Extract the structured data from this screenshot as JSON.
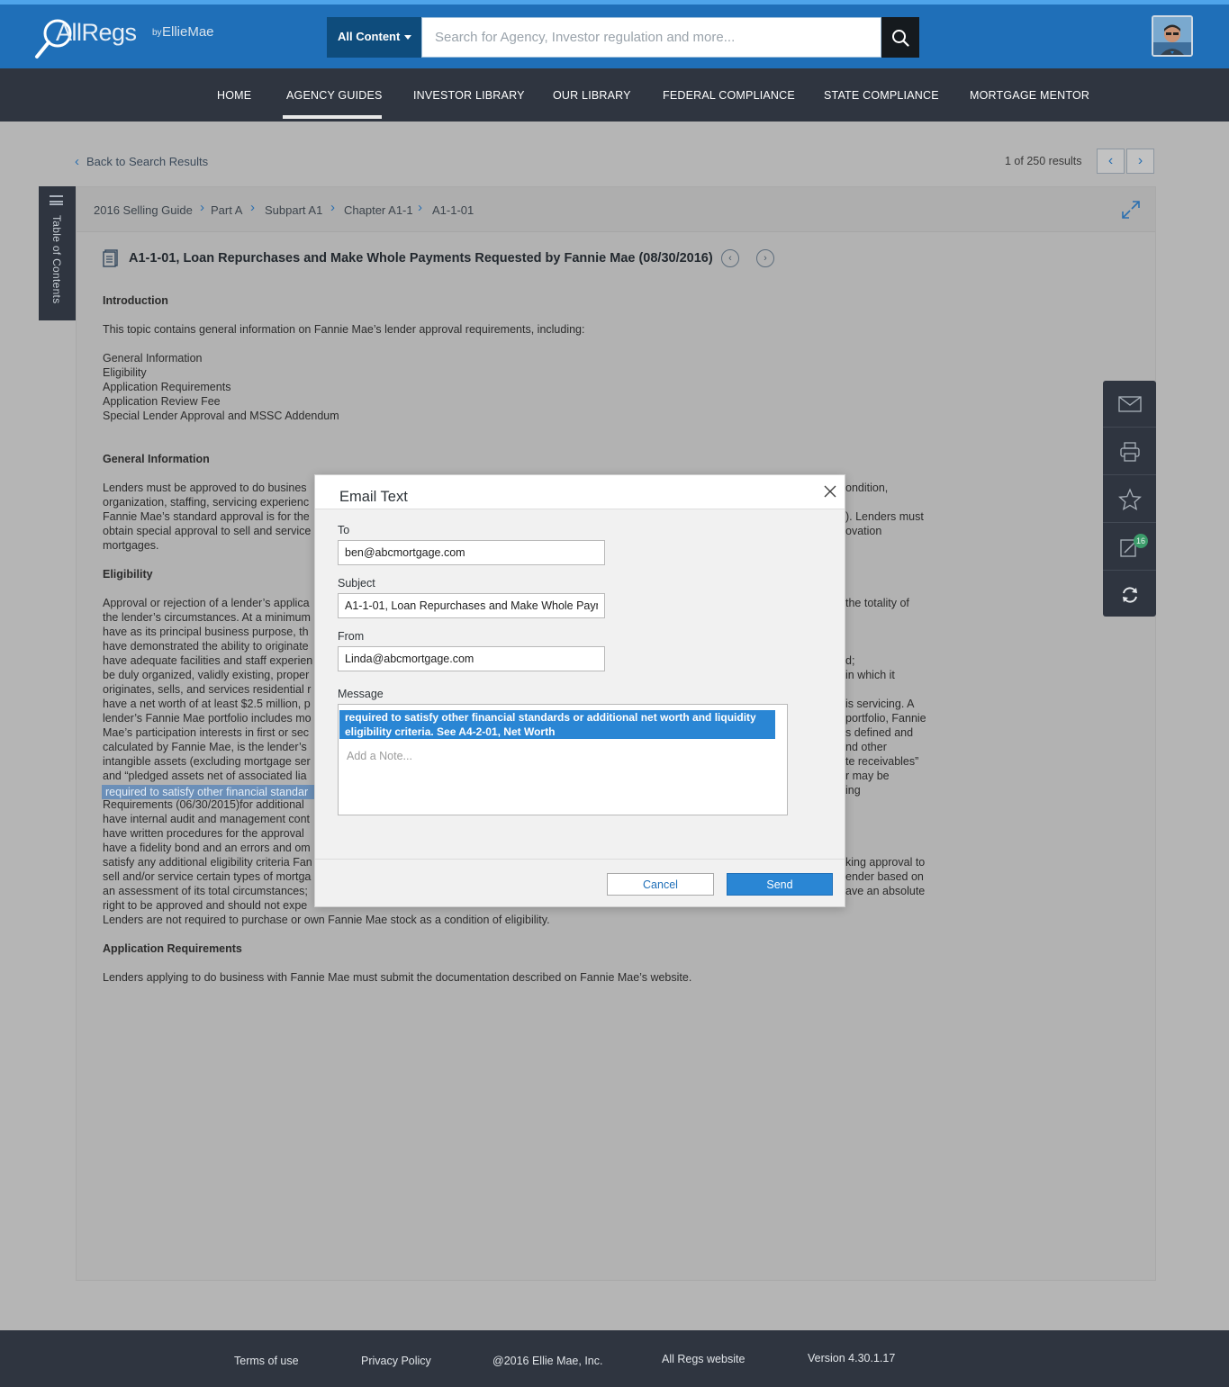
{
  "header": {
    "brand": "AllRegs",
    "by": "by",
    "brand_sub": "EllieMae",
    "search_scope": "All Content",
    "search_placeholder": "Search for Agency, Investor regulation and more..."
  },
  "nav": {
    "items": [
      "HOME",
      "AGENCY GUIDES",
      "INVESTOR LIBRARY",
      "OUR LIBRARY",
      "FEDERAL COMPLIANCE",
      "STATE COMPLIANCE",
      "MORTGAGE MENTOR"
    ],
    "active": "AGENCY GUIDES"
  },
  "results_bar": {
    "back_label": "Back to Search Results",
    "results_text": "1 of 250 results"
  },
  "breadcrumb": [
    "2016 Selling Guide",
    "Part A",
    "Subpart A1",
    "Chapter A1-1",
    "A1-1-01"
  ],
  "toc_label": "Table of Contents",
  "document": {
    "title": "A1-1-01, Loan Repurchases and Make Whole Payments Requested by Fannie Mae (08/30/2016)",
    "intro_heading": "Introduction",
    "intro_text": "This topic contains general information on Fannie Mae’s lender approval requirements, including:",
    "intro_list": [
      "General Information",
      "Eligibility",
      "Application Requirements",
      "Application Review Fee",
      "Special Lender Approval and MSSC Addendum"
    ],
    "general_heading": "General Information",
    "general_lines": [
      "Lenders must be approved to do busines",
      "organization, staffing, servicing experienc",
      "Fannie Mae’s standard approval is for the",
      "obtain special approval to sell and service",
      "mortgages."
    ],
    "general_right": [
      "ondition,",
      "). Lenders must",
      "ovation"
    ],
    "eligibility_heading": "Eligibility",
    "eligibility_lines": [
      "Approval or rejection of a lender’s applica",
      "the lender’s circumstances. At a minimum",
      "have as its principal business purpose, th",
      "have demonstrated the ability to originate",
      "have adequate facilities and staff experien",
      "be duly organized, validly existing, proper",
      "originates, sells, and services residential r",
      "have a net worth of at least $2.5 million, p",
      "lender’s Fannie Mae portfolio includes mo",
      "Mae’s participation interests in first or sec",
      "calculated by Fannie Mae, is the lender’s",
      "intangible assets (excluding mortgage ser",
      "and “pledged assets net of associated lia"
    ],
    "eligibility_right": [
      "the totality of",
      "d;",
      "in which it",
      "is servicing. A",
      "portfolio, Fannie",
      "s defined and",
      "nd other",
      "te receivables”",
      "r may be",
      "ing"
    ],
    "highlight_text": "required to satisfy other financial standar",
    "eligibility_lines_2": [
      "Requirements (06/30/2015)for additional",
      "have internal audit and management cont",
      "have written procedures for the approval",
      "have a fidelity bond and an errors and om",
      "satisfy any additional eligibility criteria Fan",
      "sell and/or service certain types of mortga",
      "an assessment of its total circumstances;",
      "right to be approved and should not expe",
      "Lenders are not required to purchase or own Fannie Mae stock as a condition of eligibility."
    ],
    "eligibility_right_2": [
      "king approval to",
      "ender based on",
      "ave an absolute"
    ],
    "app_heading": "Application Requirements",
    "app_text": "Lenders applying to do business with Fannie Mae must submit the documentation described on Fannie Mae’s website."
  },
  "tools": {
    "notes_count": "16"
  },
  "modal": {
    "title": "Email Text",
    "to_label": "To",
    "to_value": "ben@abcmortgage.com",
    "subject_label": "Subject",
    "subject_value": "A1-1-01, Loan Repurchases and Make Whole Paym",
    "from_label": "From",
    "from_value": "Linda@abcmortgage.com",
    "message_label": "Message",
    "quoted_text": "required to satisfy other financial standards or additional net worth and liquidity eligibility criteria. See A4-2-01, Net Worth",
    "note_placeholder": "Add a Note...",
    "cancel_label": "Cancel",
    "send_label": "Send"
  },
  "footer": {
    "terms": "Terms of use",
    "privacy": "Privacy Policy",
    "copyright": "@2016 Ellie Mae, Inc.",
    "website": "All Regs website",
    "version": "Version 4.30.1.17"
  },
  "colors": {
    "header_blue": "#1f6fb8",
    "nav_dark": "#2f3540",
    "accent": "#2a86d4",
    "badge_green": "#3b9b6a"
  }
}
